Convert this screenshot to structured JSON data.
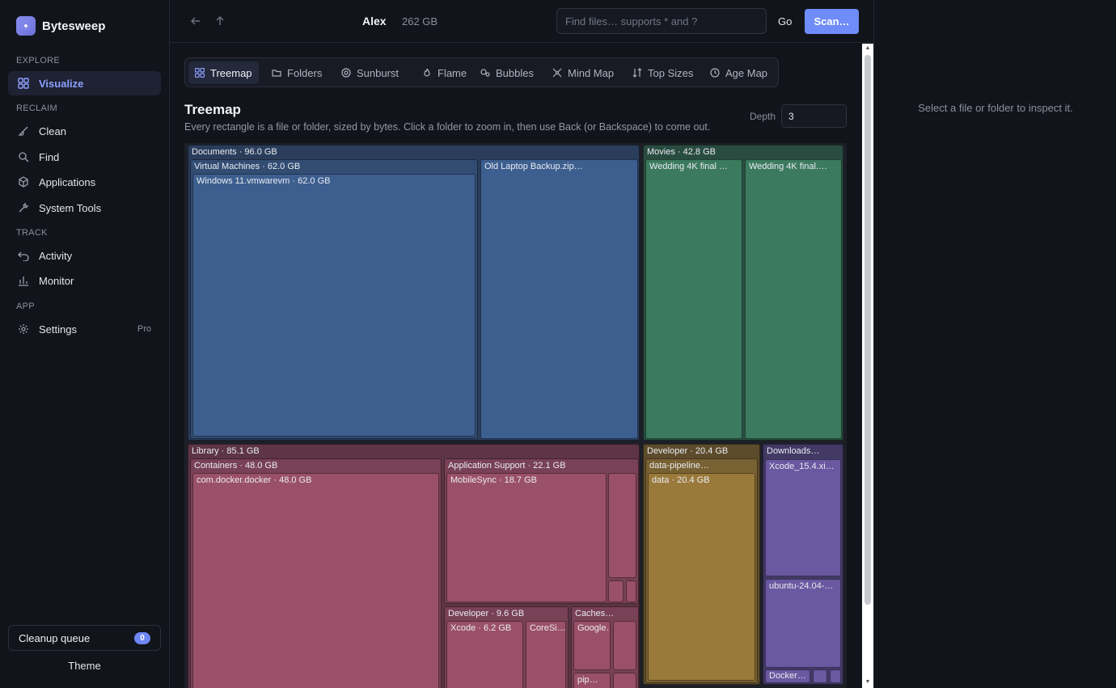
{
  "app": {
    "name": "Bytesweep"
  },
  "sidebar": {
    "sections": [
      {
        "label": "EXPLORE"
      },
      {
        "label": "RECLAIM"
      },
      {
        "label": "TRACK"
      },
      {
        "label": "APP"
      }
    ],
    "items": [
      {
        "label": "Visualize",
        "icon": "grid-icon",
        "active": true
      },
      {
        "label": "Clean",
        "icon": "broom-icon"
      },
      {
        "label": "Find",
        "icon": "search-icon"
      },
      {
        "label": "Applications",
        "icon": "package-icon"
      },
      {
        "label": "System Tools",
        "icon": "tools-icon"
      },
      {
        "label": "Activity",
        "icon": "undo-icon"
      },
      {
        "label": "Monitor",
        "icon": "bar-chart-icon"
      },
      {
        "label": "Settings",
        "icon": "gear-icon",
        "badge": "Pro"
      }
    ],
    "queue": {
      "label": "Cleanup queue",
      "count": "0"
    },
    "theme_label": "Theme"
  },
  "topbar": {
    "user": "Alex",
    "total_size": "262 GB",
    "search_placeholder": "Find files… supports * and ?",
    "go_label": "Go",
    "scan_label": "Scan…"
  },
  "tabs": [
    {
      "label": "Treemap",
      "icon": "grid-icon",
      "active": true
    },
    {
      "label": "Folders",
      "icon": "folder-icon"
    },
    {
      "label": "Sunburst",
      "icon": "sunburst-icon"
    },
    {
      "label": "Flame",
      "icon": "flame-icon"
    },
    {
      "label": "Bubbles",
      "icon": "bubbles-icon"
    },
    {
      "label": "Mind Map",
      "icon": "mindmap-icon"
    },
    {
      "label": "Top Sizes",
      "icon": "sort-icon"
    },
    {
      "label": "Age Map",
      "icon": "clock-icon"
    }
  ],
  "view": {
    "title": "Treemap",
    "description": "Every rectangle is a file or folder, sized by bytes. Click a folder to zoom in, then use Back (or Backspace) to come out.",
    "depth_label": "Depth",
    "depth_value": "3"
  },
  "treemap": {
    "colors": {
      "documents": "#3d5f8f",
      "movies": "#3b7a5e",
      "library": "#9a5068",
      "developer": "#9a7a3a",
      "downloads": "#6a58a0"
    },
    "labels": {
      "documents": "Documents · 96.0 GB",
      "virtual_machines": "Virtual Machines · 62.0 GB",
      "windows_vm": "Windows 11.vmwarevm · 62.0 GB",
      "old_laptop": "Old Laptop Backup.zip…",
      "movies": "Movies · 42.8 GB",
      "wedding1": "Wedding 4K final …",
      "wedding2": "Wedding 4K final.…",
      "library": "Library · 85.1 GB",
      "containers": "Containers · 48.0 GB",
      "docker": "com.docker.docker · 48.0 GB",
      "app_support": "Application Support · 22.1 GB",
      "mobilesync": "MobileSync · 18.7 GB",
      "lib_developer": "Developer · 9.6 GB",
      "xcode": "Xcode · 6.2 GB",
      "coresim": "CoreSi…",
      "caches": "Caches…",
      "google": "Google…",
      "pip": "pip…",
      "developer": "Developer · 20.4 GB",
      "data_pipeline": "data-pipeline…",
      "data": "data · 20.4 GB",
      "downloads": "Downloads…",
      "xcode_xip": "Xcode_15.4.xi…",
      "ubuntu": "ubuntu-24.04-…",
      "docker_dmg": "Docker…"
    }
  },
  "inspector": {
    "hint": "Select a file or folder to inspect it."
  }
}
